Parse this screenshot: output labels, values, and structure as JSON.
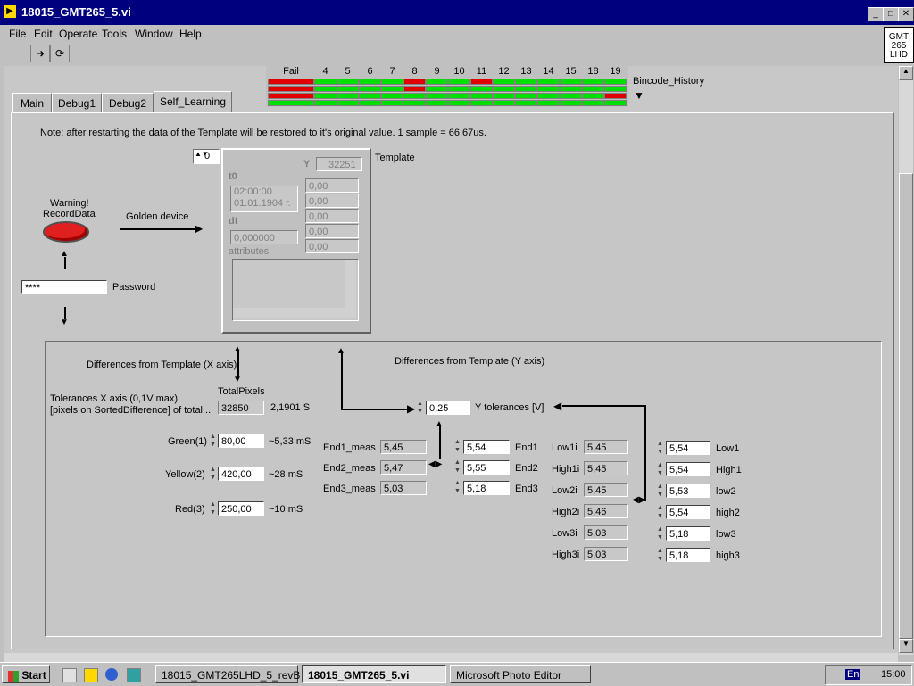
{
  "window": {
    "title": "18015_GMT265_5.vi",
    "logo_text": "GMT 265 LHD"
  },
  "menu": [
    "File",
    "Edit",
    "Operate",
    "Tools",
    "Window",
    "Help"
  ],
  "tabs": [
    "Main",
    "Debug1",
    "Debug2",
    "Self_Learning"
  ],
  "bincode": {
    "label": "Bincode_History",
    "columns": [
      "Fail",
      "4",
      "5",
      "6",
      "7",
      "8",
      "9",
      "10",
      "11",
      "12",
      "13",
      "14",
      "15",
      "18",
      "19"
    ],
    "rows": [
      [
        "red",
        "green",
        "green",
        "green",
        "green",
        "red",
        "green",
        "green",
        "red",
        "green",
        "green",
        "green",
        "green",
        "green",
        "green"
      ],
      [
        "red",
        "green",
        "green",
        "green",
        "green",
        "red",
        "green",
        "green",
        "green",
        "green",
        "green",
        "green",
        "green",
        "green",
        "green"
      ],
      [
        "red",
        "green",
        "green",
        "green",
        "green",
        "green",
        "green",
        "green",
        "green",
        "green",
        "green",
        "green",
        "green",
        "green",
        "red"
      ],
      [
        "green",
        "green",
        "green",
        "green",
        "green",
        "green",
        "green",
        "green",
        "green",
        "green",
        "green",
        "green",
        "green",
        "green",
        "green"
      ]
    ],
    "colors": {
      "red": "#e00000",
      "green": "#00e000"
    }
  },
  "note": "Note: after restarting the data of the Template will be restored to it's original value. 1 sample = 66,67us.",
  "template": {
    "label": "Template",
    "index": "0",
    "y_label": "Y",
    "y_value": "32251",
    "t0_label": "t0",
    "t0_value1": "02:00:00",
    "t0_value2": "01.01.1904 г.",
    "dt_label": "dt",
    "dt_value": "0,000000",
    "attributes_label": "attributes",
    "y_values": [
      "0,00",
      "0,00",
      "0,00",
      "0,00",
      "0,00"
    ]
  },
  "warning": {
    "line1": "Warning!",
    "line2": "RecordData"
  },
  "golden_device": "Golden device",
  "password": {
    "value": "****",
    "label": "Password"
  },
  "x_section": {
    "title": "Differences from Template (X axis)",
    "tol_line1": "Tolerances X axis (0,1V max)",
    "tol_line2": "[pixels on SortedDifference] of total...",
    "total_label": "TotalPixels",
    "total_value": "32850",
    "total_time": "2,1901 S",
    "green": {
      "label": "Green(1)",
      "value": "80,00",
      "time": "~5,33 mS"
    },
    "yellow": {
      "label": "Yellow(2)",
      "value": "420,00",
      "time": "~28 mS"
    },
    "red": {
      "label": "Red(3)",
      "value": "250,00",
      "time": "~10 mS"
    }
  },
  "y_section": {
    "title": "Differences from Template (Y axis)",
    "tol_value": "0,25",
    "tol_label": "Y tolerances [V]",
    "meas": [
      {
        "label": "End1_meas",
        "value": "5,45",
        "set": "5,54",
        "set_label": "End1"
      },
      {
        "label": "End2_meas",
        "value": "5,47",
        "set": "5,55",
        "set_label": "End2"
      },
      {
        "label": "End3_meas",
        "value": "5,03",
        "set": "5,18",
        "set_label": "End3"
      }
    ],
    "limits": [
      {
        "label": "Low1i",
        "value": "5,45",
        "set": "5,54",
        "set_label": "Low1"
      },
      {
        "label": "High1i",
        "value": "5,45",
        "set": "5,54",
        "set_label": "High1"
      },
      {
        "label": "Low2i",
        "value": "5,45",
        "set": "5,53",
        "set_label": "low2"
      },
      {
        "label": "High2i",
        "value": "5,46",
        "set": "5,54",
        "set_label": "high2"
      },
      {
        "label": "Low3i",
        "value": "5,03",
        "set": "5,18",
        "set_label": "low3"
      },
      {
        "label": "High3i",
        "value": "5,03",
        "set": "5,18",
        "set_label": "high3"
      }
    ]
  },
  "taskbar": {
    "start": "Start",
    "items": [
      "18015_GMT265LHD_5_revB",
      "18015_GMT265_5.vi",
      "Microsoft Photo Editor"
    ],
    "lang": "En",
    "clock": "15:00"
  }
}
